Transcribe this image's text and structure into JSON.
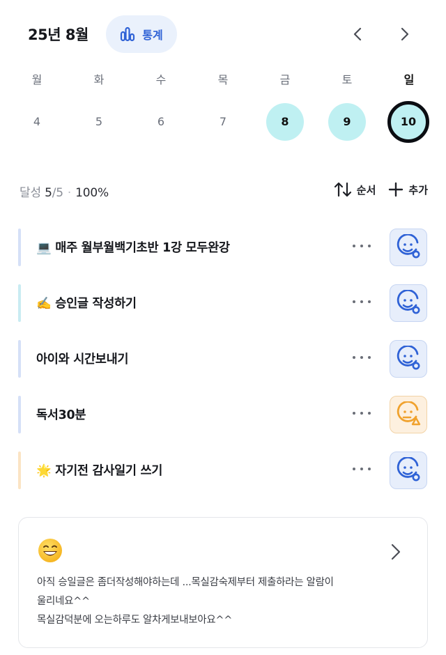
{
  "header": {
    "month_title": "25년 8월",
    "stats_label": "통계"
  },
  "weekdays": [
    "월",
    "화",
    "수",
    "목",
    "금",
    "토",
    "일"
  ],
  "dates": [
    {
      "day": "4",
      "state": "none"
    },
    {
      "day": "5",
      "state": "none"
    },
    {
      "day": "6",
      "state": "none"
    },
    {
      "day": "7",
      "state": "none"
    },
    {
      "day": "8",
      "state": "done"
    },
    {
      "day": "9",
      "state": "done"
    },
    {
      "day": "10",
      "state": "today"
    }
  ],
  "summary": {
    "label": "달성",
    "count": "5",
    "total": "/5",
    "percent": "100%",
    "order_label": "순서",
    "add_label": "추가"
  },
  "tasks": [
    {
      "title": "💻 매주 월부월백기초반 1강 모두완강",
      "bar_color": "#d5e0f7",
      "mood": "happy-icon"
    },
    {
      "title": "✍️ 승인글 작성하기",
      "bar_color": "#c9ecf2",
      "mood": "happy-icon"
    },
    {
      "title": "아이와 시간보내기",
      "bar_color": "#d5e0f7",
      "mood": "happy-icon"
    },
    {
      "title": "독서30분",
      "bar_color": "#d5e0f7",
      "mood": "neutral-warning-icon"
    },
    {
      "title": "🌟 자기전 감사일기 쓰기",
      "bar_color": "#fbe4c4",
      "mood": "happy-icon"
    }
  ],
  "memo": {
    "emoji": "grinning-face-icon",
    "line1": "아직 승일글은 좀더작성해야하는데 ...목실감숙제부터 제출하라는 알람이",
    "line2": "울리네요^^",
    "line3": "목실감덕분에 오는하루도 알차게보내보아요^^"
  },
  "colors": {
    "accent_blue": "#2f62d6",
    "done_fill": "#bff0f2",
    "mood_blue": "#2f62d6",
    "mood_orange": "#f0a22e"
  }
}
